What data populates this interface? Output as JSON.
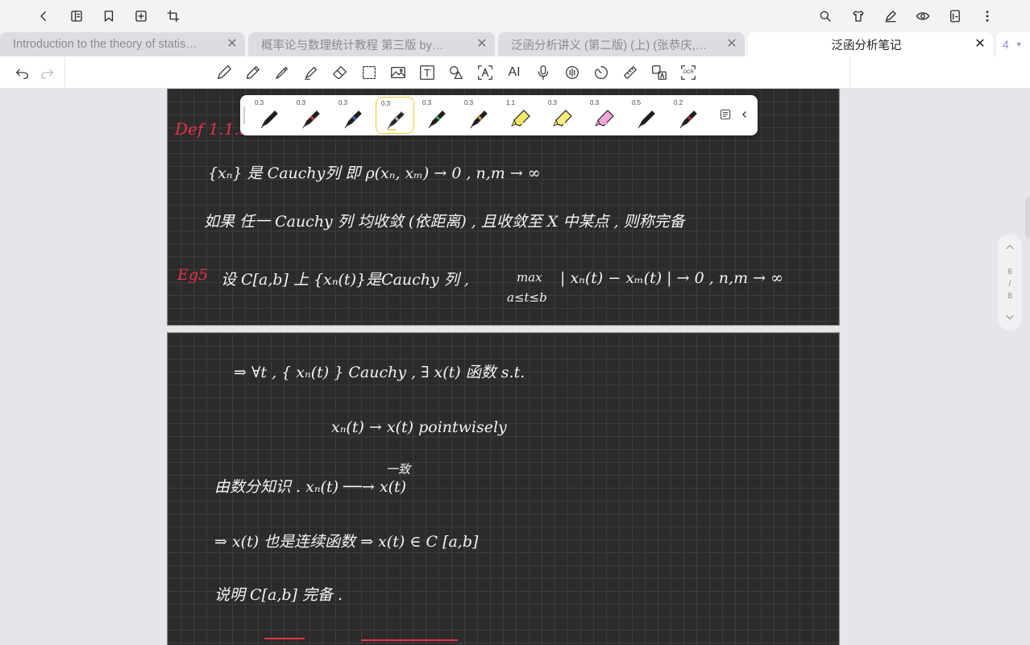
{
  "tabs": [
    {
      "label": "Introduction to the theory of statis…"
    },
    {
      "label": "概率论与数理统计教程 第三版 by…"
    },
    {
      "label": "泛函分析讲义 (第二版) (上) (张恭庆,…"
    },
    {
      "label": "泛函分析笔记"
    }
  ],
  "tab_count": "4",
  "close_glyph": "✕",
  "pens": [
    {
      "size": "0.3",
      "color": "#1a1a1a"
    },
    {
      "size": "0.3",
      "color": "#d83a3a"
    },
    {
      "size": "0.3",
      "color": "#2a6fd6"
    },
    {
      "size": "0.3",
      "color": "#ffffff"
    },
    {
      "size": "0.3",
      "color": "#2fc04a"
    },
    {
      "size": "0.3",
      "color": "#f0a020"
    },
    {
      "size": "1.1",
      "color": "#f3e86a"
    },
    {
      "size": "0.3",
      "color": "#f5ea7c"
    },
    {
      "size": "0.3",
      "color": "#f2a7d8"
    },
    {
      "size": "0.5",
      "color": "#1a1a1a"
    },
    {
      "size": "0.2",
      "color": "#c62a2a"
    }
  ],
  "toolbar": {
    "text_tool": "T",
    "ai_tool": "AI",
    "ocr_tool": "OCR"
  },
  "page_nav": {
    "current": "6",
    "sep": "/",
    "total": "8"
  },
  "note": {
    "def_label": "Def 1.1.5",
    "line1": "{xₙ} 是 Cauchy列 即   ρ(xₙ, xₘ) → 0 ,     n,m → ∞",
    "line2": "如果 任一 Cauchy 列 均收敛 (依距离) ,  且收敛至 X 中某点 , 则称完备",
    "eg_label": "Eg5",
    "line3": "设 C[a,b] 上 {xₙ(t)}是Cauchy 列 ,",
    "max_top": "max",
    "max_bottom": "a≤t≤b",
    "line3b": "| xₙ(t) − xₘ(t) | → 0 ,     n,m → ∞",
    "p2_line1": "⇒ ∀t ,   { xₙ(t) } Cauchy ,    ∃ x(t) 函数      s.t.",
    "p2_line2": "xₙ(t) → x(t)      pointwisely",
    "p2_line3": "由数分知识 .   xₙ(t)  ──→  x(t)",
    "p2_arrow_label": "一致",
    "p2_line4": "⇒  x(t) 也是连续函数    ⇒    x(t) ∈ C [a,b]",
    "p2_line5": "说明 C[a,b] 完备 ."
  }
}
